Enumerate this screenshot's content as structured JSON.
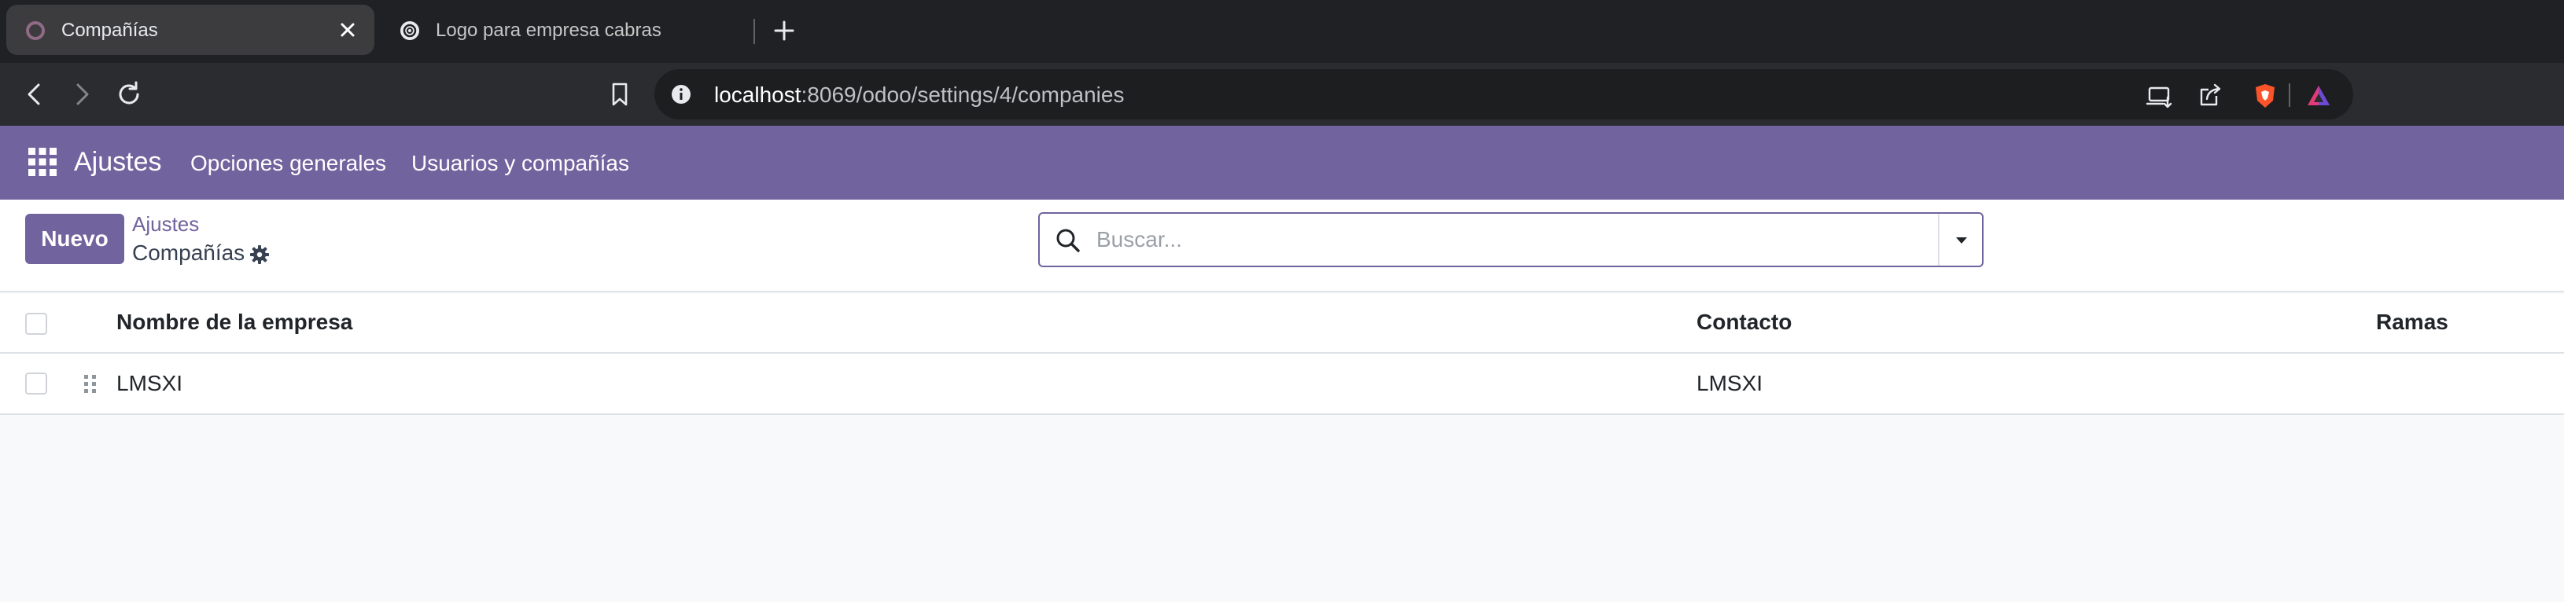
{
  "browser": {
    "tabs": [
      {
        "title": "Compañías",
        "active": true,
        "favicon": "odoo-circle-icon"
      },
      {
        "title": "Logo para empresa cabras",
        "active": false,
        "favicon": "chatgpt-icon"
      }
    ],
    "url_host": "localhost",
    "url_rest": ":8069/odoo/settings/4/companies"
  },
  "navbar": {
    "brand": "Ajustes",
    "menu": [
      "Opciones generales",
      "Usuarios y compañías"
    ],
    "color": "#71639e"
  },
  "control_panel": {
    "new_button": "Nuevo",
    "breadcrumb_parent": "Ajustes",
    "breadcrumb_current": "Compañías",
    "search_placeholder": "Buscar..."
  },
  "list": {
    "columns": [
      "Nombre de la empresa",
      "Contacto",
      "Ramas"
    ],
    "rows": [
      {
        "name": "LMSXI",
        "contact": "LMSXI",
        "branches": ""
      }
    ]
  }
}
